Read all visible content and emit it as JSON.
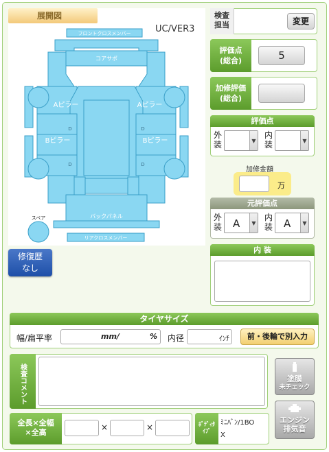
{
  "diagram": {
    "title": "展開図",
    "version": "UC/VER3",
    "labels": {
      "front_cross_member": "フロントクロスメンバー",
      "core_support": "コアサポ",
      "a_pillar_left": "Aピラー",
      "a_pillar_right": "Aピラー",
      "b_pillar_left": "Bピラー",
      "b_pillar_right": "Bピラー",
      "back_panel": "バックパネル",
      "rear_cross_member": "リアクロスメンバー",
      "spare": "スペア",
      "d_marks": [
        "D",
        "D",
        "D",
        "D"
      ]
    },
    "colors": {
      "fill": "#8ad7f2",
      "stroke": "#3a9fc8"
    }
  },
  "repair_history": {
    "line1": "修復歴",
    "line2": "なし"
  },
  "inspector": {
    "label_line1": "検査",
    "label_line2": "担当",
    "value": "",
    "change_button": "変更"
  },
  "score_total": {
    "label_line1": "評価点",
    "label_line2": "(総合)",
    "value": "5"
  },
  "repair_score": {
    "label_line1": "加修評価",
    "label_line2": "(総合)",
    "value": ""
  },
  "rating": {
    "header": "評価点",
    "exterior_label_1": "外",
    "exterior_label_2": "装",
    "interior_label_1": "内",
    "interior_label_2": "装",
    "exterior_value": "",
    "interior_value": ""
  },
  "repair_amount": {
    "label": "加修金額",
    "value": "",
    "unit": "万"
  },
  "original_rating": {
    "header": "元評価点",
    "exterior_label_1": "外",
    "exterior_label_2": "装",
    "interior_label_1": "内",
    "interior_label_2": "装",
    "exterior_value": "A",
    "interior_value": "A"
  },
  "interior": {
    "header": "内 装",
    "value": ""
  },
  "tire": {
    "header": "タイヤサイズ",
    "width_label": "幅/扁平率",
    "width_mid": "mm/",
    "width_end": "%",
    "diameter_label": "内径",
    "diameter_unit": "ｲﾝﾁ",
    "split_button": "前・後輪で別入力"
  },
  "comment": {
    "label": "コメント",
    "label_top": "検査",
    "value": ""
  },
  "paint_button": {
    "line1": "塗膜",
    "line2": "未チェック"
  },
  "dimensions": {
    "label_line1": "全長×全幅",
    "label_line2": "×全高",
    "sep1": "×",
    "sep2": "×"
  },
  "body_type": {
    "label_line1": "ﾎﾞﾃﾞｨﾀ",
    "label_line2": "ｲﾌﾟ",
    "value_line1": "ﾐﾆﾊﾞﾝ/1BO",
    "value_line2": "X"
  },
  "engine_button": {
    "line1": "エンジン",
    "line2": "排気音"
  }
}
